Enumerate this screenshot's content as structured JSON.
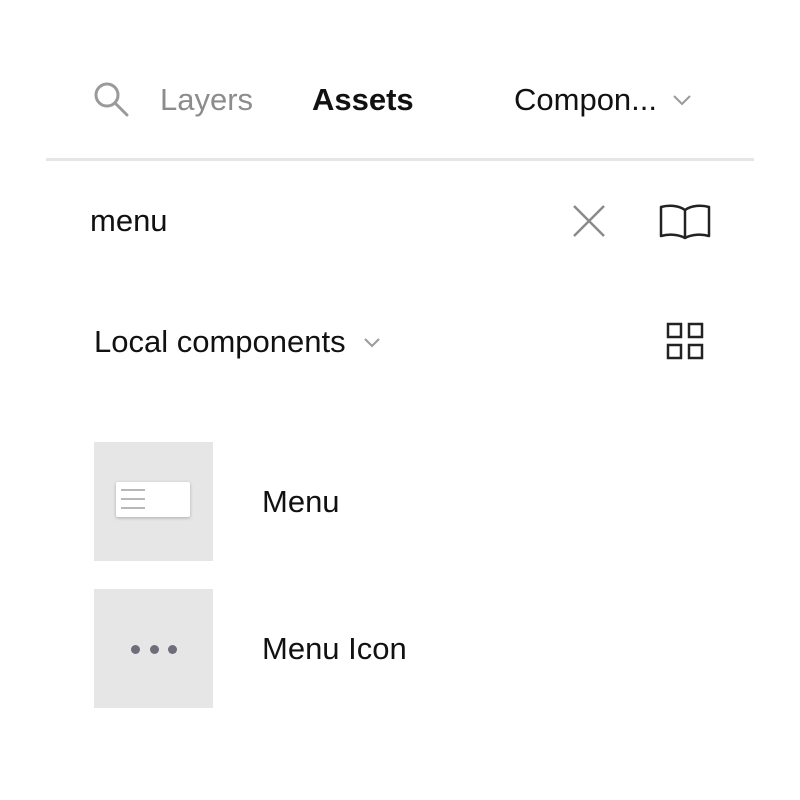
{
  "tabs": {
    "search_icon": "search-icon",
    "layers_label": "Layers",
    "assets_label": "Assets",
    "library_select_label": "Compon...",
    "active_tab": "Assets"
  },
  "search": {
    "value": "menu",
    "clear_icon": "close-icon",
    "library_icon": "book-icon"
  },
  "section": {
    "label": "Local components",
    "view_toggle_icon": "grid-view-icon"
  },
  "components": [
    {
      "name": "Menu",
      "thumbnail": "menu-preview"
    },
    {
      "name": "Menu Icon",
      "thumbnail": "ellipsis-icon"
    }
  ],
  "colors": {
    "active_tab": "#111111",
    "inactive_tab": "#8c8c8c",
    "divider": "#e6e6e6",
    "thumbnail_bg": "#e6e6e6",
    "dots": "#6e6e7a"
  }
}
